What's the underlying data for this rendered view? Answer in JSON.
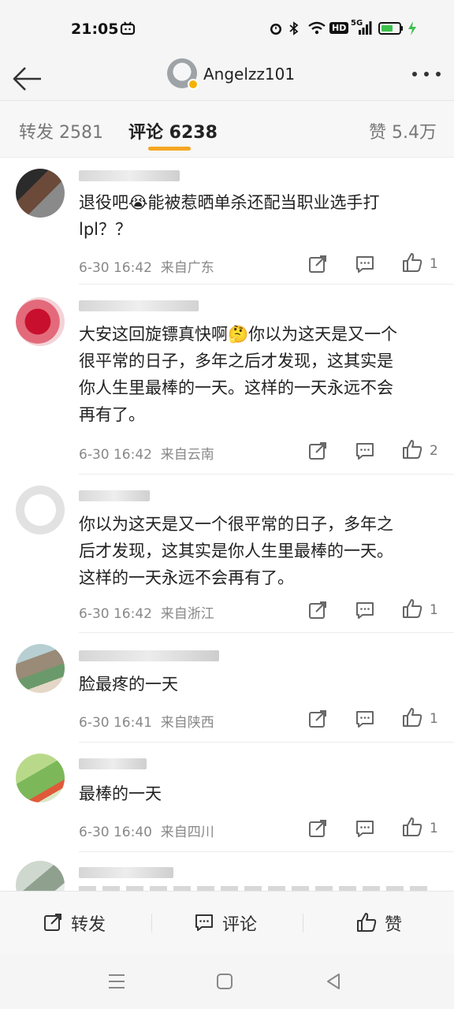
{
  "status_bar": {
    "time": "21:05",
    "network": "5G",
    "hd": "HD"
  },
  "header": {
    "username": "Angelzz101"
  },
  "tabs": [
    {
      "label": "转发 2581"
    },
    {
      "label": "评论 6238",
      "active": true
    },
    {
      "label": "赞 5.4万"
    }
  ],
  "comments": [
    {
      "text": [
        "退役吧😭能被惹晒单杀还配当职业选手打",
        "lpl？？"
      ],
      "time": "6-30 16:42",
      "location": "来自广东",
      "likes": "1"
    },
    {
      "text": [
        "大安这回旋镖真快啊🤔你以为这天是又一个",
        "很平常的日子，多年之后才发现，这其实是",
        "你人生里最棒的一天。这样的一天永远不会",
        "再有了。"
      ],
      "time": "6-30 16:42",
      "location": "来自云南",
      "likes": "2"
    },
    {
      "text": [
        "你以为这天是又一个很平常的日子，多年之",
        "后才发现，这其实是你人生里最棒的一天。",
        "这样的一天永远不会再有了。"
      ],
      "time": "6-30 16:42",
      "location": "来自浙江",
      "likes": "1"
    },
    {
      "text": [
        "脸最疼的一天"
      ],
      "time": "6-30 16:41",
      "location": "来自陕西",
      "likes": "1"
    },
    {
      "text": [
        "最棒的一天"
      ],
      "time": "6-30 16:40",
      "location": "来自四川",
      "likes": "1"
    }
  ],
  "bottom_bar": {
    "repost": "转发",
    "comment": "评论",
    "like": "赞"
  },
  "colors": {
    "accent": "#f5a623",
    "meta_gray": "#888888"
  }
}
